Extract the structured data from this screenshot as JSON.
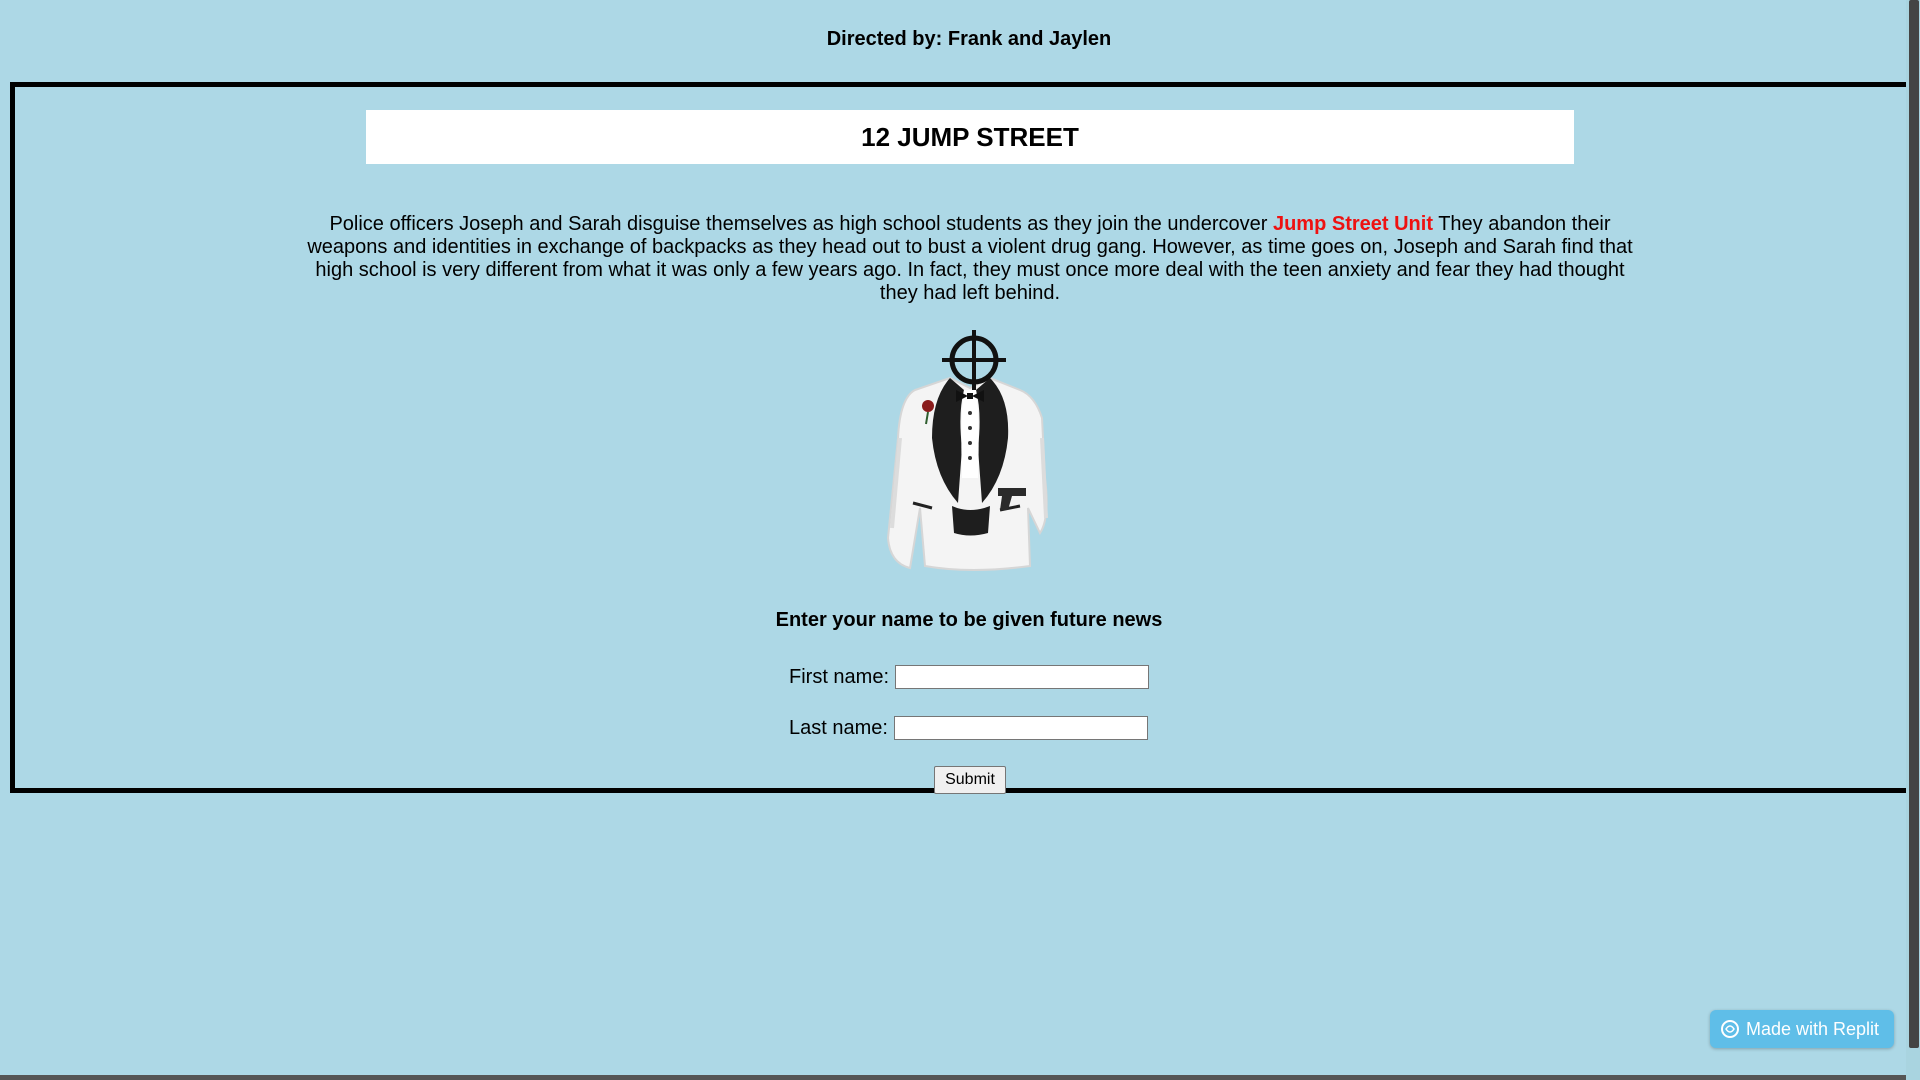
{
  "header": {
    "director": "Directed by: Frank and Jaylen"
  },
  "main": {
    "title": "12 JUMP STREET",
    "description_before": "Police officers Joseph and Sarah disguise themselves as high school students as they join the undercover ",
    "description_highlight": "Jump Street Unit",
    "description_after": " They abandon their weapons and identities in exchange of backpacks as they head out to bust a violent drug gang. However, as time goes on, Joseph and Sarah find that high school is very different from what it was only a few years ago. In fact, they must once more deal with the teen anxiety and fear they had thought they had left behind.",
    "image_icon": "tuxedo-crosshair-icon"
  },
  "form": {
    "heading": "Enter your name to be given future news",
    "first_name_label": "First name:",
    "first_name_value": "",
    "last_name_label": "Last name:",
    "last_name_value": "",
    "submit_label": "Submit"
  },
  "badge": {
    "label": "Made with Replit",
    "icon": "replit-icon"
  },
  "colors": {
    "background": "#add8e6",
    "highlight": "#ee1111",
    "badge": "#5fbee8"
  }
}
